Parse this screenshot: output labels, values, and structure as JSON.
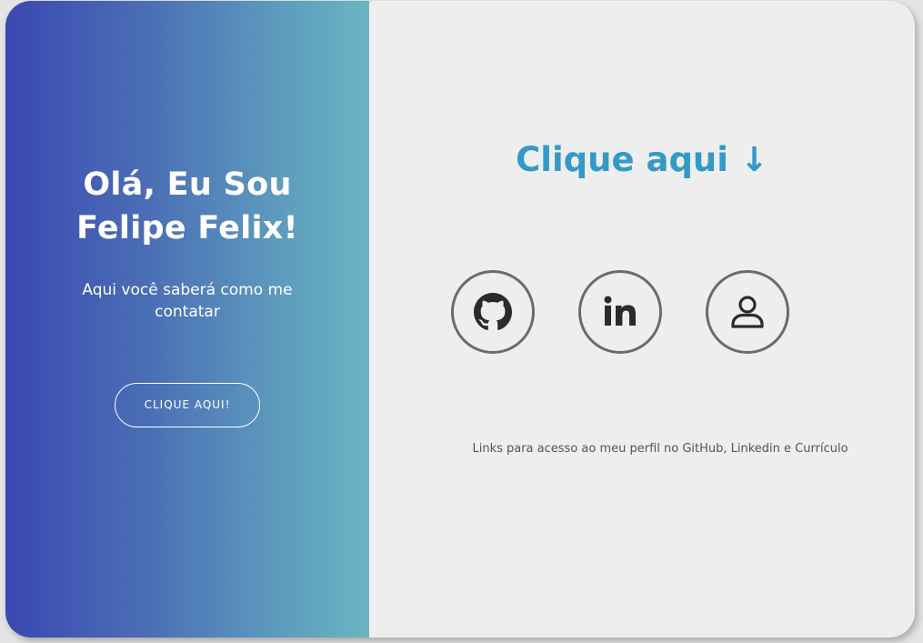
{
  "hero": {
    "title_line1": "Olá, Eu Sou",
    "title_line2": "Felipe Felix!",
    "subtitle": "Aqui você saberá como me contatar",
    "cta_label": "CLIQUE AQUI!"
  },
  "contact": {
    "title": "Clique aqui ↓",
    "links": [
      {
        "name": "GitHub",
        "icon": "github-icon"
      },
      {
        "name": "Linkedin",
        "icon": "linkedin-icon"
      },
      {
        "name": "Currículo",
        "icon": "user-icon"
      }
    ],
    "caption": "Links para acesso ao meu perfil no GitHub, Linkedin e Currículo"
  },
  "colors": {
    "gradient_start": "#3a48b2",
    "gradient_end": "#6ab5c2",
    "accent": "#3399c7",
    "panel_bg": "#eeeeee",
    "icon": "#2b2b2b",
    "circle_border": "#6b6b6b"
  }
}
